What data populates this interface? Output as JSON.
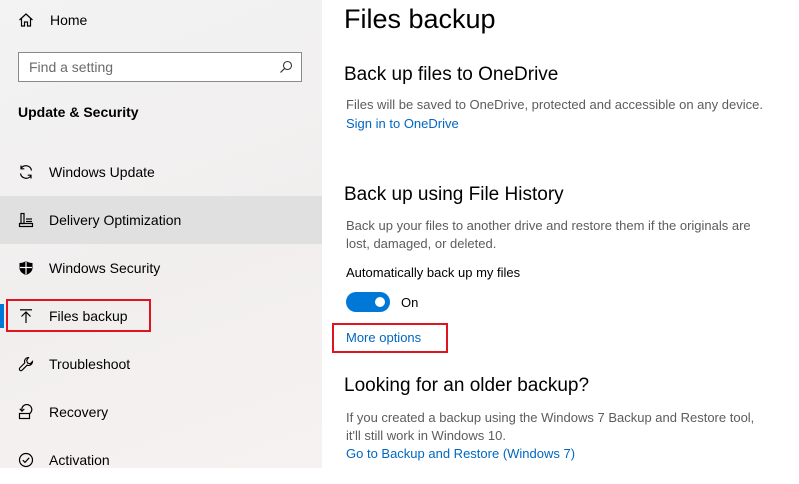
{
  "sidebar": {
    "home_label": "Home",
    "search_placeholder": "Find a setting",
    "section_title": "Update & Security",
    "items": [
      {
        "label": "Windows Update",
        "icon": "sync-icon"
      },
      {
        "label": "Delivery Optimization",
        "icon": "delivery-optimization-icon"
      },
      {
        "label": "Windows Security",
        "icon": "shield-icon"
      },
      {
        "label": "Files backup",
        "icon": "backup-arrow-icon",
        "selected": true
      },
      {
        "label": "Troubleshoot",
        "icon": "wrench-icon"
      },
      {
        "label": "Recovery",
        "icon": "recovery-icon"
      },
      {
        "label": "Activation",
        "icon": "activation-icon"
      }
    ]
  },
  "main": {
    "title": "Files backup",
    "onedrive": {
      "heading": "Back up files to OneDrive",
      "description": "Files will be saved to OneDrive, protected and accessible on any device.",
      "link": "Sign in to OneDrive"
    },
    "file_history": {
      "heading": "Back up using File History",
      "description_line1": "Back up your files to another drive and restore them if the originals are",
      "description_line2": "lost, damaged, or deleted.",
      "toggle_label": "Automatically back up my files",
      "toggle_state": "On",
      "more_options": "More options"
    },
    "older_backup": {
      "heading": "Looking for an older backup?",
      "description_line1": "If you created a backup using the Windows 7 Backup and Restore tool,",
      "description_line2": "it'll still work in Windows 10.",
      "link": "Go to Backup and Restore (Windows 7)"
    }
  },
  "colors": {
    "accent": "#0078d7",
    "link": "#0067c0",
    "highlight_box": "#e0141e",
    "sidebar_bg": "#f3f3f3",
    "hover_bg": "#e0e0e0"
  }
}
